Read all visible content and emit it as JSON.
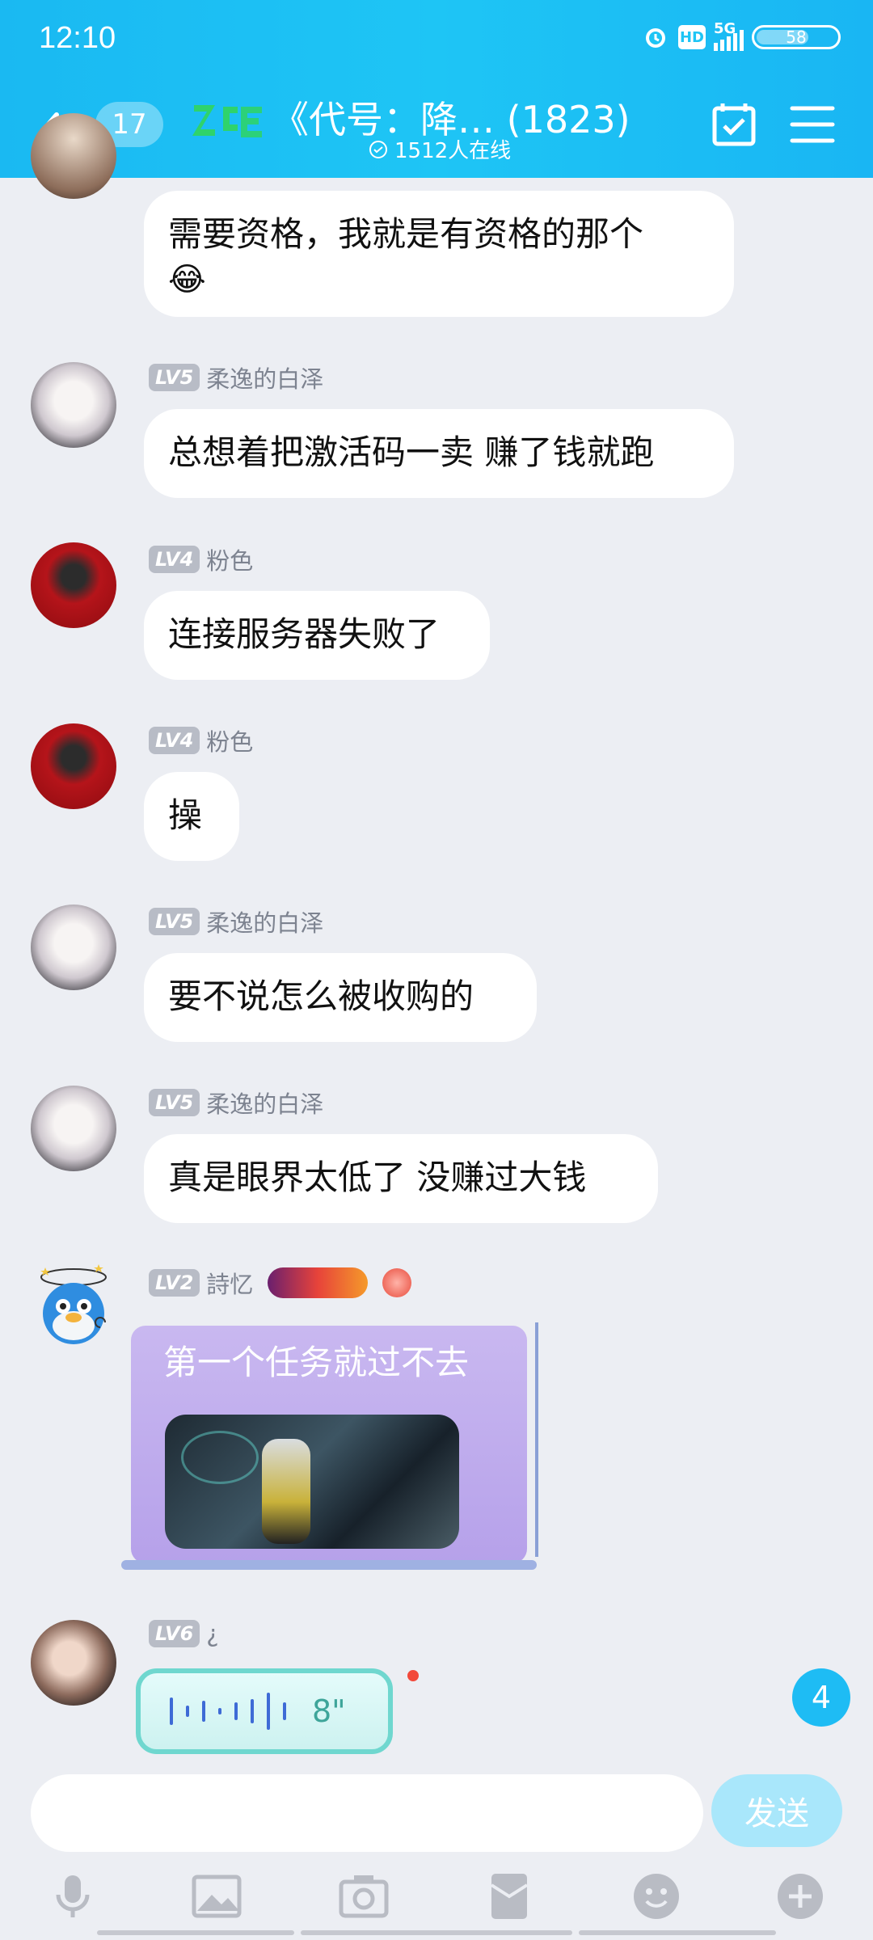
{
  "status_bar": {
    "time": "12:10",
    "network": "5G",
    "hd": "HD",
    "battery": "58"
  },
  "nav": {
    "unread_count": "17",
    "group_title": "《代号：降…  (1823)",
    "online_text": "1512人在线"
  },
  "messages": [
    {
      "text_line1": "需要资格，我就是有资格的那个",
      "emoji": "😂"
    },
    {
      "level": "LV5",
      "name": "柔逸的白泽",
      "text": "总想着把激活码一卖 赚了钱就跑"
    },
    {
      "level": "LV4",
      "name": "粉色",
      "text": "连接服务器失败了"
    },
    {
      "level": "LV4",
      "name": "粉色",
      "text": "操"
    },
    {
      "level": "LV5",
      "name": "柔逸的白泽",
      "text": "要不说怎么被收购的"
    },
    {
      "level": "LV5",
      "name": "柔逸的白泽",
      "text": "真是眼界太低了 没赚过大钱"
    },
    {
      "level": "LV2",
      "name": "詩忆",
      "text": "第一个任务就过不去"
    },
    {
      "level": "LV6",
      "name": "¿",
      "voice_duration": "8\""
    }
  ],
  "new_message_count": "4",
  "input": {
    "send_label": "发送",
    "placeholder": ""
  },
  "toolbar": [
    "microphone-icon",
    "image-icon",
    "camera-icon",
    "red-packet-icon",
    "emoji-icon",
    "plus-icon"
  ],
  "colors": {
    "header": "#1ec5f5",
    "bubble": "#ffffff",
    "background": "#eceef3",
    "accent": "#1ebcf4"
  }
}
